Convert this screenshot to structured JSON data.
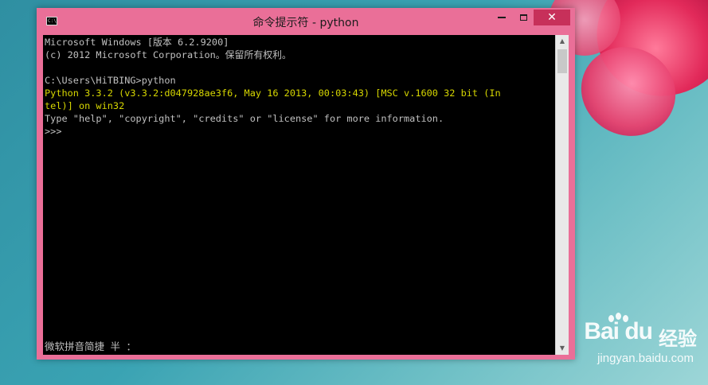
{
  "window": {
    "title": "命令提示符 - python",
    "icon_label": "C:\\",
    "controls": {
      "minimize": "minimize-icon",
      "maximize": "maximize-icon",
      "close": "✕"
    }
  },
  "console": {
    "lines": [
      {
        "text": "Microsoft Windows [版本 6.2.9200]",
        "color": "#c0c0c0"
      },
      {
        "text": "(c) 2012 Microsoft Corporation。保留所有权利。",
        "color": "#c0c0c0"
      },
      {
        "text": "",
        "color": "#c0c0c0"
      },
      {
        "text": "C:\\Users\\HiTBING>python",
        "color": "#c0c0c0"
      },
      {
        "text": "Python 3.3.2 (v3.3.2:d047928ae3f6, May 16 2013, 00:03:43) [MSC v.1600 32 bit (In",
        "color": "#d6d600"
      },
      {
        "text": "tel)] on win32",
        "color": "#d6d600"
      },
      {
        "text": "Type \"help\", \"copyright\", \"credits\" or \"license\" for more information.",
        "color": "#c0c0c0"
      },
      {
        "text": ">>>",
        "color": "#c0c0c0"
      }
    ],
    "ime_status": "微软拼音简捷 半 ："
  },
  "scrollbar": {
    "up_arrow": "▲",
    "down_arrow": "▼"
  },
  "watermark": {
    "logo": "Bai du",
    "brand": "经验",
    "url": "jingyan.baidu.com"
  },
  "colors": {
    "window_frame": "#ea6f98",
    "close_button": "#c7305a",
    "console_bg": "#000000",
    "console_text": "#c0c0c0",
    "python_banner": "#d6d600"
  }
}
